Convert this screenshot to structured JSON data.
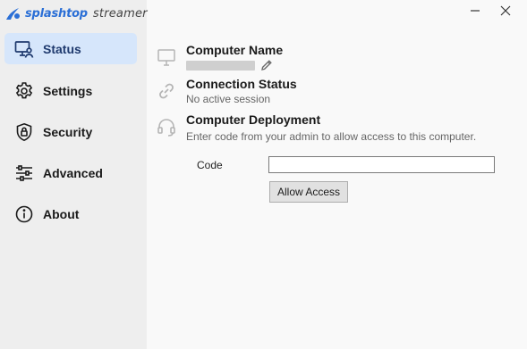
{
  "app": {
    "brand": "splashtop",
    "product": "streamer",
    "logo_icon": "splashtop-logo-icon",
    "accent_color": "#2b6fd6"
  },
  "window_controls": {
    "minimize_icon": "minimize-icon",
    "close_icon": "close-icon"
  },
  "sidebar": {
    "items": [
      {
        "label": "Status",
        "icon": "monitor-user-icon",
        "active": true
      },
      {
        "label": "Settings",
        "icon": "gear-icon",
        "active": false
      },
      {
        "label": "Security",
        "icon": "shield-lock-icon",
        "active": false
      },
      {
        "label": "Advanced",
        "icon": "sliders-icon",
        "active": false
      },
      {
        "label": "About",
        "icon": "info-icon",
        "active": false
      }
    ]
  },
  "status": {
    "computer_name": {
      "title": "Computer Name",
      "icon": "monitor-icon",
      "edit_icon": "pencil-icon"
    },
    "connection": {
      "title": "Connection Status",
      "value": "No active session",
      "icon": "link-icon"
    },
    "deployment": {
      "title": "Computer Deployment",
      "description": "Enter code from your admin to allow access to this computer.",
      "icon": "headset-icon",
      "code_label": "Code",
      "code_value": "",
      "button_label": "Allow Access"
    }
  }
}
